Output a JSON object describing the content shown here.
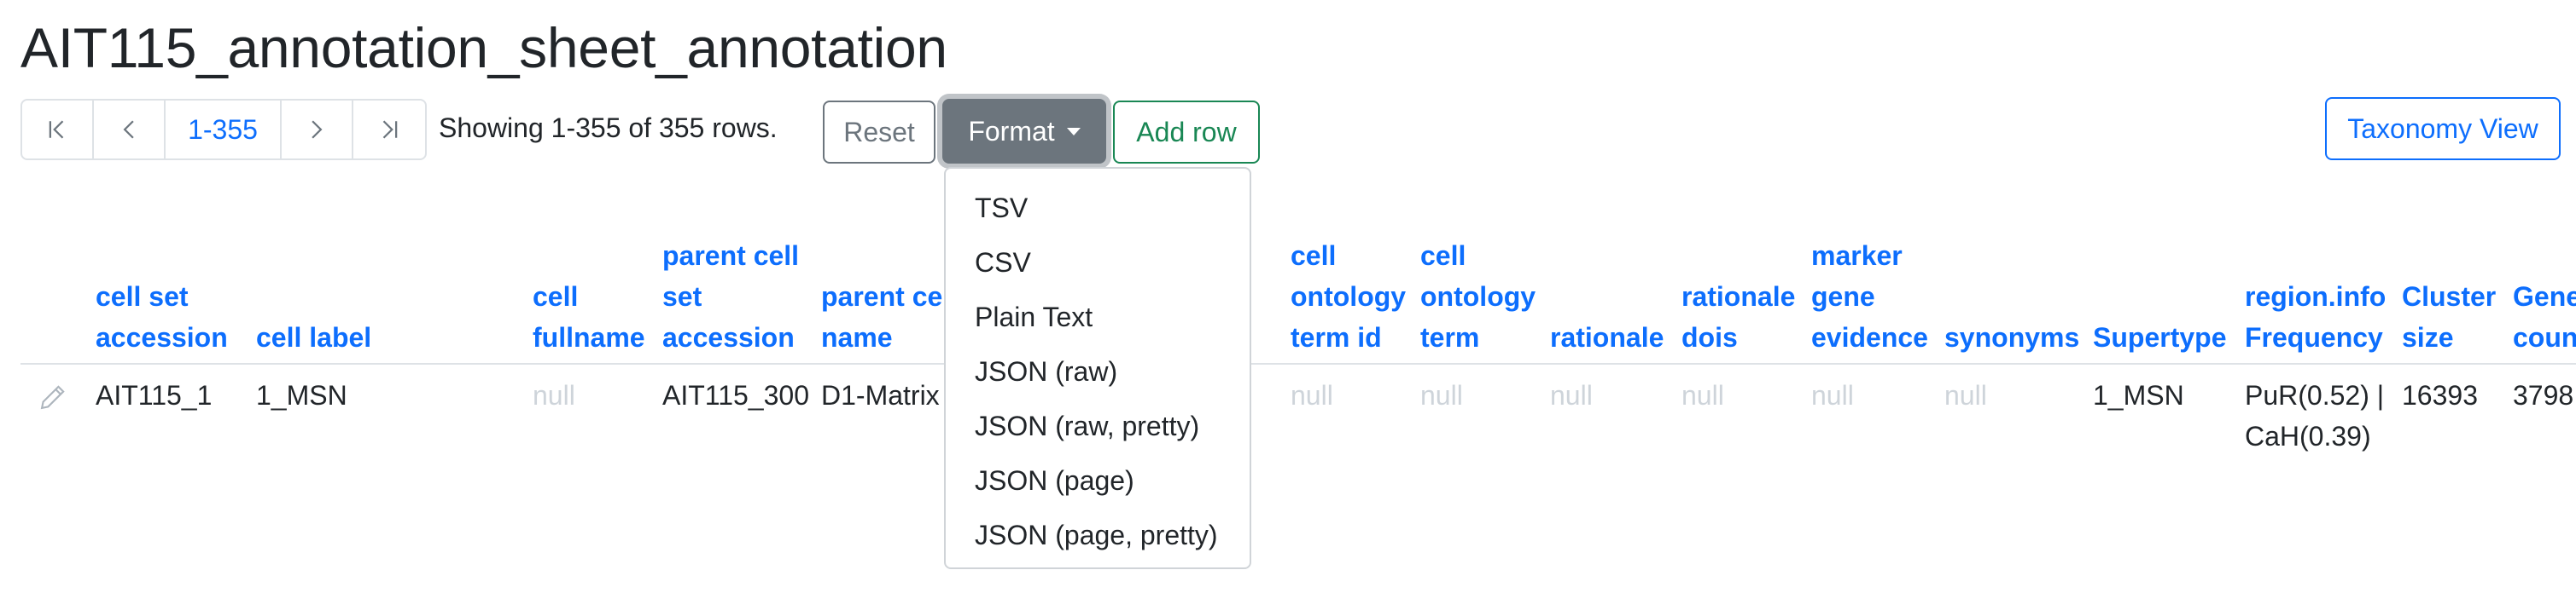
{
  "page": {
    "title": "AIT115_annotation_sheet_annotation"
  },
  "pagination": {
    "range_label": "1-355",
    "showing": "Showing 1-355 of 355 rows."
  },
  "toolbar": {
    "reset": "Reset",
    "format": "Format",
    "add_row": "Add row",
    "taxonomy_view": "Taxonomy View"
  },
  "format_menu": [
    "TSV",
    "CSV",
    "Plain Text",
    "JSON (raw)",
    "JSON (raw, pretty)",
    "JSON (page)",
    "JSON (page, pretty)"
  ],
  "columns": [
    [
      "cell set",
      "accession"
    ],
    [
      "cell label"
    ],
    [
      "cell",
      "fullname"
    ],
    [
      "parent cell",
      "set",
      "accession"
    ],
    [
      "parent ce",
      "name"
    ],
    [
      "cell",
      "ontology",
      "term id"
    ],
    [
      "cell",
      "ontology",
      "term"
    ],
    [
      "rationale"
    ],
    [
      "rationale",
      "dois"
    ],
    [
      "marker",
      "gene",
      "evidence"
    ],
    [
      "synonyms"
    ],
    [
      "Supertype"
    ],
    [
      "region.info",
      "Frequency"
    ],
    [
      "Cluster",
      "size"
    ],
    [
      "Gene",
      "coun"
    ]
  ],
  "rows": [
    {
      "cells": [
        "AIT115_1",
        "1_MSN",
        "null",
        "AIT115_300",
        "D1-Matrix",
        "null",
        "null",
        "null",
        "null",
        "null",
        "null",
        "1_MSN",
        [
          "PuR(0.52) |",
          "CaH(0.39)"
        ],
        "16393",
        "3798"
      ],
      "nulls": [
        2,
        5,
        6,
        7,
        8,
        9,
        10
      ]
    }
  ],
  "colors": {
    "primary": "#0d6efd",
    "secondary": "#6c757d",
    "success": "#198754",
    "null_text": "#ced4da"
  },
  "icons": [
    "first-page-icon",
    "prev-page-icon",
    "next-page-icon",
    "last-page-icon",
    "pencil-icon",
    "caret-down-icon"
  ]
}
